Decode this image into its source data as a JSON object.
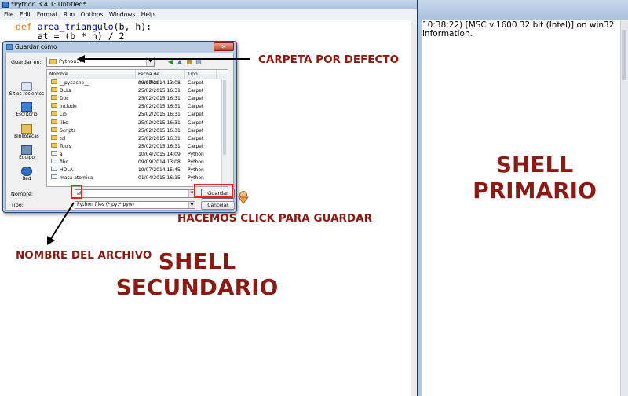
{
  "editor": {
    "title": "*Python 3.4.1: Untitled*",
    "menu": [
      "File",
      "Edit",
      "Format",
      "Run",
      "Options",
      "Windows",
      "Help"
    ],
    "code_line1_keyword": "def",
    "code_line1_name": "area_triangulo",
    "code_line1_rest": "(b, h):",
    "code_line2": "    at = (b * h) / 2"
  },
  "shell": {
    "line1": "10:38:22) [MSC v.1600 32 bit (Intel)] on win32",
    "line2": "information."
  },
  "dialog": {
    "title": "Guardar como",
    "close_symbol": "✕",
    "save_in_label": "Guardar en:",
    "save_in_value": "Python34",
    "places": [
      "Sitios recientes",
      "Escritorio",
      "Bibliotecas",
      "Equipo",
      "Red"
    ],
    "columns": [
      "Nombre",
      "Fecha de modifica...",
      "Tipo"
    ],
    "files": [
      {
        "name": "__pycache__",
        "date": "09/09/2014 13:08",
        "type": "Carpet",
        "kind": "folder"
      },
      {
        "name": "DLLs",
        "date": "25/02/2015 16:31",
        "type": "Carpet",
        "kind": "folder"
      },
      {
        "name": "Doc",
        "date": "25/02/2015 16:31",
        "type": "Carpet",
        "kind": "folder"
      },
      {
        "name": "include",
        "date": "25/02/2015 16:31",
        "type": "Carpet",
        "kind": "folder"
      },
      {
        "name": "Lib",
        "date": "25/02/2015 16:31",
        "type": "Carpet",
        "kind": "folder"
      },
      {
        "name": "libs",
        "date": "25/02/2015 16:31",
        "type": "Carpet",
        "kind": "folder"
      },
      {
        "name": "Scripts",
        "date": "25/02/2015 16:31",
        "type": "Carpet",
        "kind": "folder"
      },
      {
        "name": "tcl",
        "date": "25/02/2015 16:31",
        "type": "Carpet",
        "kind": "folder"
      },
      {
        "name": "Tools",
        "date": "25/02/2015 16:31",
        "type": "Carpet",
        "kind": "folder"
      },
      {
        "name": "a",
        "date": "10/04/2015 14:09",
        "type": "Python",
        "kind": "py"
      },
      {
        "name": "fibo",
        "date": "09/09/2014 13:08",
        "type": "Python",
        "kind": "py"
      },
      {
        "name": "HOLA",
        "date": "19/07/2014 15:45",
        "type": "Python",
        "kind": "py"
      },
      {
        "name": "masa atomica",
        "date": "01/04/2015 16:15",
        "type": "Python",
        "kind": "py"
      }
    ],
    "filename_label": "Nombre:",
    "filename_value": "at",
    "filetype_label": "Tipo:",
    "filetype_value": "Python files (*.py;*.pyw)",
    "save_button": "Guardar",
    "cancel_button": "Cancelar"
  },
  "annotations": {
    "default_folder": "CARPETA POR DEFECTO",
    "click_to_save": "HACEMOS CLICK PARA GUARDAR",
    "file_name": "NOMBRE DEL ARCHIVO",
    "secondary_shell_line1": "SHELL",
    "secondary_shell_line2": "SECUNDARIO",
    "primary_shell_line1": "SHELL",
    "primary_shell_line2": "PRIMARIO"
  },
  "colors": {
    "annotation_text": "#8b1a14",
    "highlight_box": "#ff1a1a",
    "window_frame": "#b3c8e0"
  }
}
